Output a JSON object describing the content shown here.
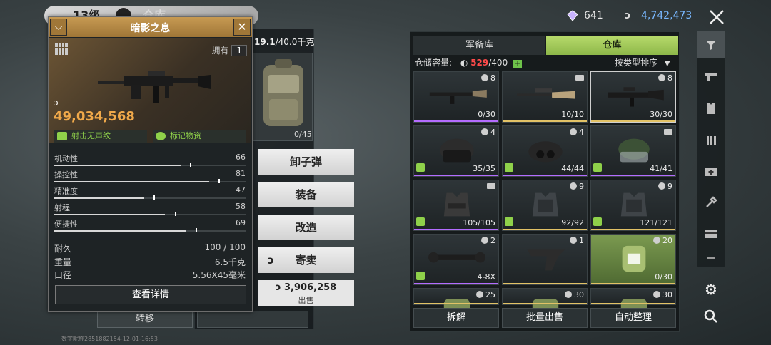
{
  "header": {
    "level_label": "13级",
    "tab_label": "仓库",
    "gems": "641",
    "coins": "4,742,473"
  },
  "background_panel": {
    "weight_current": "19.1",
    "weight_max": "/40.0千克",
    "bag_count": "0/45",
    "transfer_label": "转移",
    "watermark": "数字昵称2851882154-12-01-16:53"
  },
  "item": {
    "name": "暗影之息",
    "own_label": "拥有",
    "own_count": "1",
    "price": "49,034,568",
    "traits": [
      "射击无声纹",
      "标记物资"
    ],
    "stats": [
      {
        "label": "机动性",
        "value": "66",
        "fill": 0.66
      },
      {
        "label": "操控性",
        "value": "81",
        "fill": 0.81
      },
      {
        "label": "精准度",
        "value": "47",
        "fill": 0.47
      },
      {
        "label": "射程",
        "value": "58",
        "fill": 0.58
      },
      {
        "label": "便捷性",
        "value": "69",
        "fill": 0.69
      }
    ],
    "durability_label": "耐久",
    "durability_value": "100 / 100",
    "weight_label": "重量",
    "weight_value": "6.5千克",
    "caliber_label": "口径",
    "caliber_value": "5.56X45毫米",
    "detail_button": "查看详情"
  },
  "actions": {
    "unload": "卸子弹",
    "equip": "装备",
    "modify": "改造",
    "consign": "寄卖",
    "sell_price": "3,906,258",
    "sell_label": "出售"
  },
  "warehouse": {
    "tab_armory": "军备库",
    "tab_warehouse": "仓库",
    "capacity_label": "仓储容量:",
    "capacity_used": "529",
    "capacity_max": "/400",
    "sort_label": "按类型排序",
    "cells": [
      {
        "badge": "8",
        "count": "0/30",
        "kind": "rifle",
        "rarity": "#b46cff"
      },
      {
        "badge": "",
        "count": "10/10",
        "kind": "sniper",
        "rarity": "#e2c266"
      },
      {
        "badge": "8",
        "count": "30/30",
        "kind": "rifle2",
        "rarity": "#e2c266"
      },
      {
        "badge": "4",
        "count": "35/35",
        "kind": "helmet",
        "rarity": "#b46cff"
      },
      {
        "badge": "4",
        "count": "44/44",
        "kind": "nvg",
        "rarity": "#b46cff"
      },
      {
        "badge": "",
        "count": "41/41",
        "kind": "helmet2",
        "rarity": "#b46cff"
      },
      {
        "badge": "",
        "count": "105/105",
        "kind": "vest",
        "rarity": "#b46cff"
      },
      {
        "badge": "9",
        "count": "92/92",
        "kind": "armor",
        "rarity": "#e2c266"
      },
      {
        "badge": "9",
        "count": "121/121",
        "kind": "armor",
        "rarity": "#e2c266"
      },
      {
        "badge": "2",
        "count": "4-8X",
        "kind": "scope",
        "rarity": "#b46cff"
      },
      {
        "badge": "1",
        "count": "",
        "kind": "grip",
        "rarity": "#e2c266"
      },
      {
        "badge": "20",
        "count": "0/30",
        "kind": "bag",
        "rarity": "#e2c266"
      },
      {
        "badge": "25",
        "count": "",
        "kind": "bag2",
        "rarity": "#e2c266"
      },
      {
        "badge": "30",
        "count": "",
        "kind": "bag2",
        "rarity": "#e2c266"
      },
      {
        "badge": "30",
        "count": "",
        "kind": "bag2",
        "rarity": "#e2c266"
      }
    ],
    "btn_dismantle": "拆解",
    "btn_bulk_sell": "批量出售",
    "btn_auto_sort": "自动整理"
  },
  "colors": {
    "accent_green": "#8fd14a",
    "gold": "#c79a52",
    "price_orange": "#f0a94a",
    "coin_blue": "#79b8ff"
  }
}
